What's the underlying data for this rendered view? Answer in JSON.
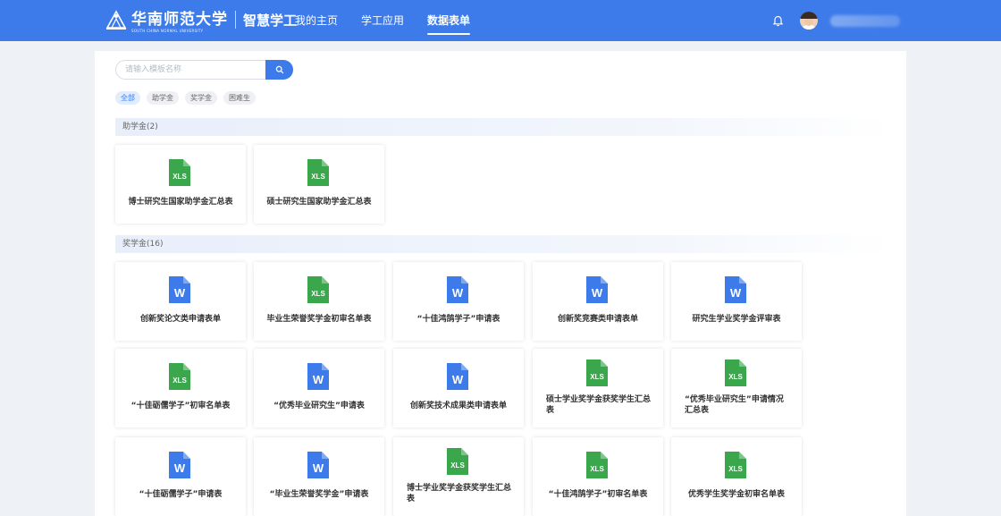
{
  "header": {
    "logo_cn": "华南师范大学",
    "logo_en": "SOUTH CHINA NORMAL UNIVERSITY",
    "system_name": "智慧学工",
    "nav": [
      "我的主页",
      "学工应用",
      "数据表单"
    ],
    "active_nav": "数据表单",
    "username": "**********"
  },
  "search": {
    "placeholder": "请输入模板名称",
    "value": ""
  },
  "filters": [
    {
      "label": "全部",
      "active": true
    },
    {
      "label": "助学金",
      "active": false
    },
    {
      "label": "奖学金",
      "active": false
    },
    {
      "label": "困难生",
      "active": false
    }
  ],
  "sections": [
    {
      "title": "助学金(2)",
      "items": [
        {
          "title": "博士研究生国家助学金汇总表",
          "type": "xls"
        },
        {
          "title": "硕士研究生国家助学金汇总表",
          "type": "xls"
        }
      ]
    },
    {
      "title": "奖学金(16)",
      "items": [
        {
          "title": "创新奖论文类申请表单",
          "type": "doc"
        },
        {
          "title": "毕业生荣誉奖学金初审名单表",
          "type": "xls"
        },
        {
          "title": "“十佳鸿鹄学子”申请表",
          "type": "doc"
        },
        {
          "title": "创新奖竞赛类申请表单",
          "type": "doc"
        },
        {
          "title": "研究生学业奖学金评审表",
          "type": "doc"
        },
        {
          "title": "“十佳砺儒学子”初审名单表",
          "type": "xls"
        },
        {
          "title": "“优秀毕业研究生”申请表",
          "type": "doc"
        },
        {
          "title": "创新奖技术成果类申请表单",
          "type": "doc"
        },
        {
          "title": "硕士学业奖学金获奖学生汇总表",
          "type": "xls"
        },
        {
          "title": "“优秀毕业研究生”申请情况汇总表",
          "type": "xls"
        },
        {
          "title": "“十佳砺儒学子”申请表",
          "type": "doc"
        },
        {
          "title": "“毕业生荣誉奖学金”申请表",
          "type": "doc"
        },
        {
          "title": "博士学业奖学金获奖学生汇总表",
          "type": "xls"
        },
        {
          "title": "“十佳鸿鹄学子”初审名单表",
          "type": "xls"
        },
        {
          "title": "优秀学生奖学金初审名单表",
          "type": "xls"
        }
      ]
    }
  ],
  "icons": {
    "xls_label": "XLS",
    "doc_label": "W",
    "xls_color": "#3aa74c",
    "doc_color": "#3d7bea",
    "brand_color": "#3d7bea"
  }
}
